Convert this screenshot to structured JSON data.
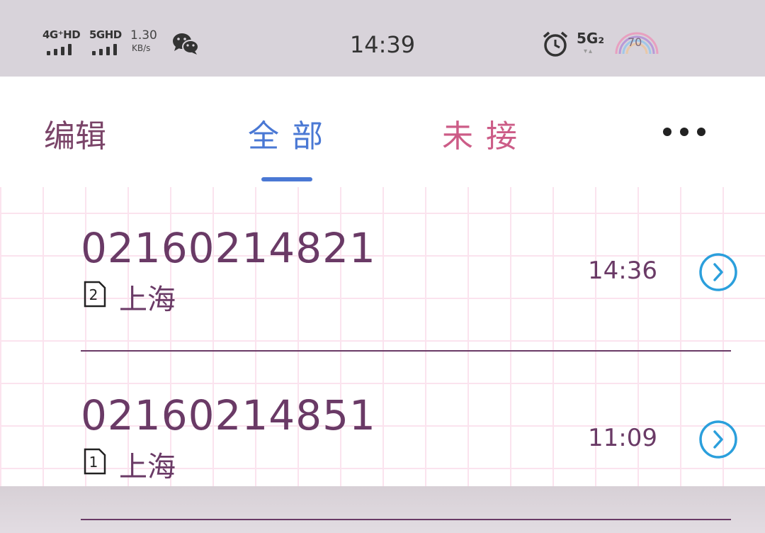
{
  "status_bar": {
    "signal1": "4G⁺HD",
    "signal2": "5GHD",
    "speed_value": "1.30",
    "speed_unit": "KB/s",
    "time": "14:39",
    "network": "5G₂",
    "battery_level": "70",
    "icons": [
      "wechat-icon",
      "alarm-icon",
      "battery-icon"
    ]
  },
  "tabs": {
    "edit": "编辑",
    "all": "全部",
    "missed": "未接",
    "more_icon": "more-icon",
    "active": "all"
  },
  "calls": [
    {
      "number": "02160214821",
      "sim": "2",
      "location": "上海",
      "time": "14:36"
    },
    {
      "number": "02160214851",
      "sim": "1",
      "location": "上海",
      "time": "11:09"
    }
  ],
  "colors": {
    "accent": "#4a78d4",
    "missed": "#cc5c87",
    "text": "#6a3a66",
    "detail_icon": "#2b9fdc",
    "grid": "#fbe3ee",
    "status_bg": "#d8d3da"
  }
}
